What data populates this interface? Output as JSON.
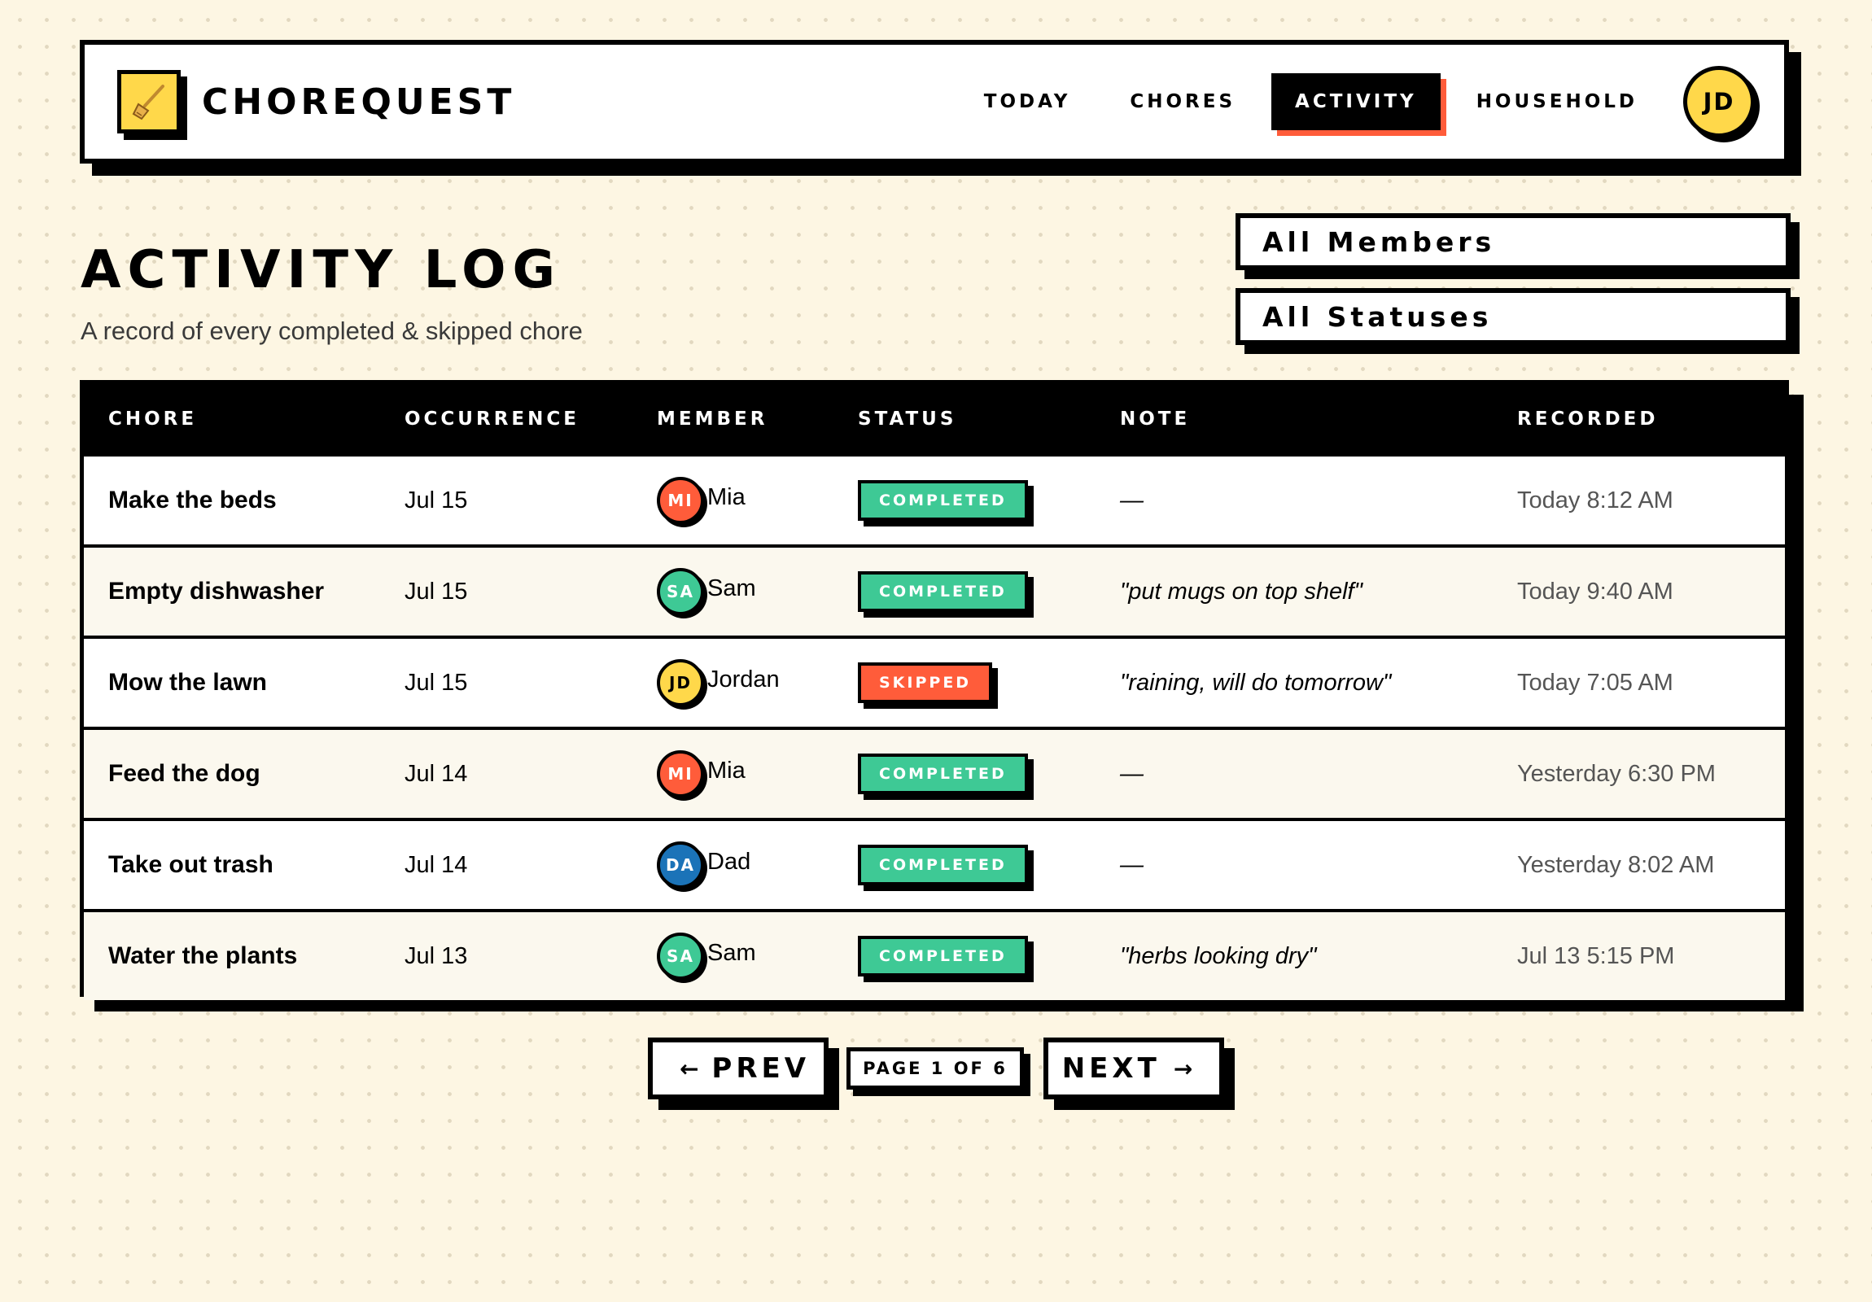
{
  "app": {
    "name": "CHOREQUEST",
    "logo_icon": "broom-icon"
  },
  "nav": {
    "items": [
      {
        "label": "TODAY",
        "active": false
      },
      {
        "label": "CHORES",
        "active": false
      },
      {
        "label": "ACTIVITY",
        "active": true
      },
      {
        "label": "HOUSEHOLD",
        "active": false
      }
    ],
    "user_initials": "JD"
  },
  "page": {
    "title": "ACTIVITY LOG",
    "subtitle": "A record of every completed & skipped chore"
  },
  "filters": {
    "members": "All Members",
    "statuses": "All Statuses"
  },
  "table": {
    "columns": [
      "CHORE",
      "OCCURRENCE",
      "MEMBER",
      "STATUS",
      "NOTE",
      "RECORDED"
    ],
    "rows": [
      {
        "chore": "Make the beds",
        "occurrence": "Jul 15",
        "initials": "MI",
        "member": "Mia",
        "status": "COMPLETED",
        "note": "—",
        "recorded": "Today 8:12 AM"
      },
      {
        "chore": "Empty dishwasher",
        "occurrence": "Jul 15",
        "initials": "SA",
        "member": "Sam",
        "status": "COMPLETED",
        "note": "\"put mugs on top shelf\"",
        "recorded": "Today 9:40 AM"
      },
      {
        "chore": "Mow the lawn",
        "occurrence": "Jul 15",
        "initials": "JD",
        "member": "Jordan",
        "status": "SKIPPED",
        "note": "\"raining, will do tomorrow\"",
        "recorded": "Today 7:05 AM"
      },
      {
        "chore": "Feed the dog",
        "occurrence": "Jul 14",
        "initials": "MI",
        "member": "Mia",
        "status": "COMPLETED",
        "note": "—",
        "recorded": "Yesterday 6:30 PM"
      },
      {
        "chore": "Take out trash",
        "occurrence": "Jul 14",
        "initials": "DA",
        "member": "Dad",
        "status": "COMPLETED",
        "note": "—",
        "recorded": "Yesterday 8:02 AM"
      },
      {
        "chore": "Water the plants",
        "occurrence": "Jul 13",
        "initials": "SA",
        "member": "Sam",
        "status": "COMPLETED",
        "note": "\"herbs looking dry\"",
        "recorded": "Jul 13 5:15 PM"
      }
    ]
  },
  "member_colors": {
    "MI": "#ff5c3a",
    "SA": "#3ec995",
    "JD": "#ffd84a",
    "DA": "#1b73b8"
  },
  "status_colors": {
    "COMPLETED": "#3ec995",
    "SKIPPED": "#ff5c3a"
  },
  "pagination": {
    "prev_label": "PREV",
    "next_label": "NEXT",
    "page_label": "PAGE 1 OF 6",
    "prev_icon": "arrow-left-icon",
    "next_icon": "arrow-right-icon"
  }
}
